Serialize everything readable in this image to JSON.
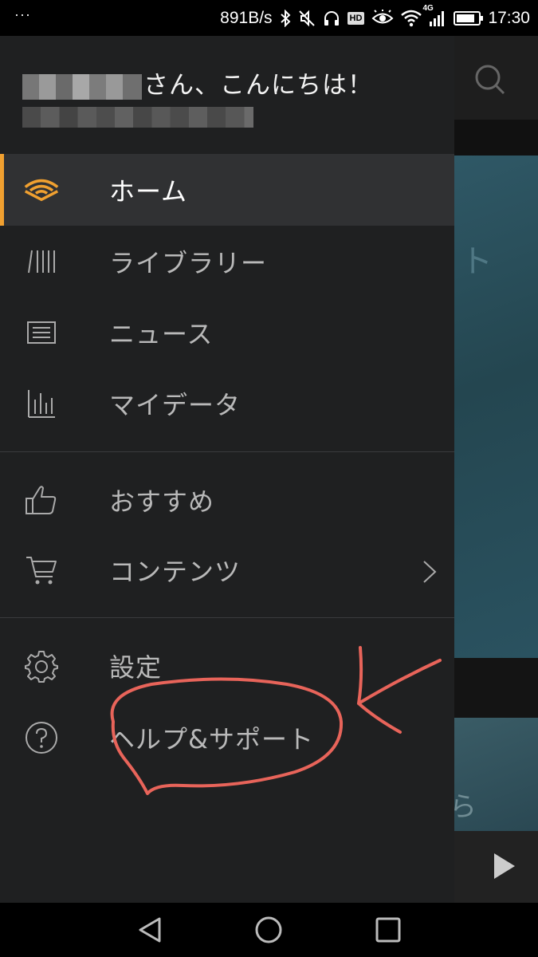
{
  "status_bar": {
    "dots": "···",
    "network_speed": "891B/s",
    "hd_badge": "HD",
    "network_type": "4G",
    "time": "17:30",
    "battery_level": 0.85
  },
  "drawer": {
    "greeting_suffix": "さん、こんにちは！",
    "menu": {
      "home": "ホーム",
      "library": "ライブラリー",
      "news": "ニュース",
      "mydata": "マイデータ",
      "recommend": "おすすめ",
      "contents": "コンテンツ",
      "settings": "設定",
      "help": "ヘルプ&サポート"
    },
    "accent_color": "#f0a030"
  },
  "background_app": {
    "hero_text": "ト",
    "card_text": "ら"
  },
  "annotation": {
    "color": "#e8645a",
    "icons": [
      "circle-annotation",
      "arrow-annotation"
    ]
  },
  "icons": [
    "search-icon",
    "audible-icon",
    "library-icon",
    "news-icon",
    "chart-icon",
    "thumbs-up-icon",
    "cart-icon",
    "gear-icon",
    "help-icon",
    "chevron-right-icon",
    "play-icon",
    "back-icon",
    "home-icon",
    "recents-icon"
  ]
}
